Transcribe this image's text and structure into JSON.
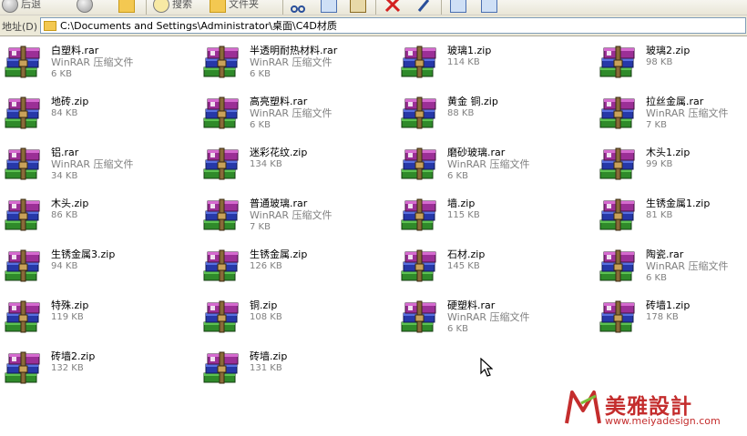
{
  "toolbar": {
    "back_label": "后退",
    "search_label": "搜索",
    "folders_label": "文件夹"
  },
  "address": {
    "label": "地址(D)",
    "path": "C:\\Documents and Settings\\Administrator\\桌面\\C4D材质"
  },
  "files": [
    {
      "name": "白塑料.rar",
      "type": "WinRAR 压缩文件",
      "size": "6 KB"
    },
    {
      "name": "半透明耐热材料.rar",
      "type": "WinRAR 压缩文件",
      "size": "6 KB"
    },
    {
      "name": "玻璃1.zip",
      "type": "",
      "size": "114 KB"
    },
    {
      "name": "玻璃2.zip",
      "type": "",
      "size": "98 KB"
    },
    {
      "name": "地砖.zip",
      "type": "",
      "size": "84 KB"
    },
    {
      "name": "高亮塑料.rar",
      "type": "WinRAR 压缩文件",
      "size": "6 KB"
    },
    {
      "name": "黄金 铜.zip",
      "type": "",
      "size": "88 KB"
    },
    {
      "name": "拉丝金属.rar",
      "type": "WinRAR 压缩文件",
      "size": "7 KB"
    },
    {
      "name": "铝.rar",
      "type": "WinRAR 压缩文件",
      "size": "34 KB"
    },
    {
      "name": "迷彩花纹.zip",
      "type": "",
      "size": "134 KB"
    },
    {
      "name": "磨砂玻璃.rar",
      "type": "WinRAR 压缩文件",
      "size": "6 KB"
    },
    {
      "name": "木头1.zip",
      "type": "",
      "size": "99 KB"
    },
    {
      "name": "木头.zip",
      "type": "",
      "size": "86 KB"
    },
    {
      "name": "普通玻璃.rar",
      "type": "WinRAR 压缩文件",
      "size": "7 KB"
    },
    {
      "name": "墙.zip",
      "type": "",
      "size": "115 KB"
    },
    {
      "name": "生锈金属1.zip",
      "type": "",
      "size": "81 KB"
    },
    {
      "name": "生锈金属3.zip",
      "type": "",
      "size": "94 KB"
    },
    {
      "name": "生锈金属.zip",
      "type": "",
      "size": "126 KB"
    },
    {
      "name": "石材.zip",
      "type": "",
      "size": "145 KB"
    },
    {
      "name": "陶瓷.rar",
      "type": "WinRAR 压缩文件",
      "size": "6 KB"
    },
    {
      "name": "特殊.zip",
      "type": "",
      "size": "119 KB"
    },
    {
      "name": "铜.zip",
      "type": "",
      "size": "108 KB"
    },
    {
      "name": "硬塑料.rar",
      "type": "WinRAR 压缩文件",
      "size": "6 KB"
    },
    {
      "name": "砖墙1.zip",
      "type": "",
      "size": "178 KB"
    },
    {
      "name": "砖墙2.zip",
      "type": "",
      "size": "132 KB"
    },
    {
      "name": "砖墙.zip",
      "type": "",
      "size": "131 KB"
    }
  ],
  "watermark": {
    "title": "美雅設計",
    "url": "www.meiyadesign.com"
  },
  "icons": {
    "file": "winrar-archive-icon",
    "cursor": "mouse-pointer-icon",
    "logo": "meiya-logo-icon"
  }
}
